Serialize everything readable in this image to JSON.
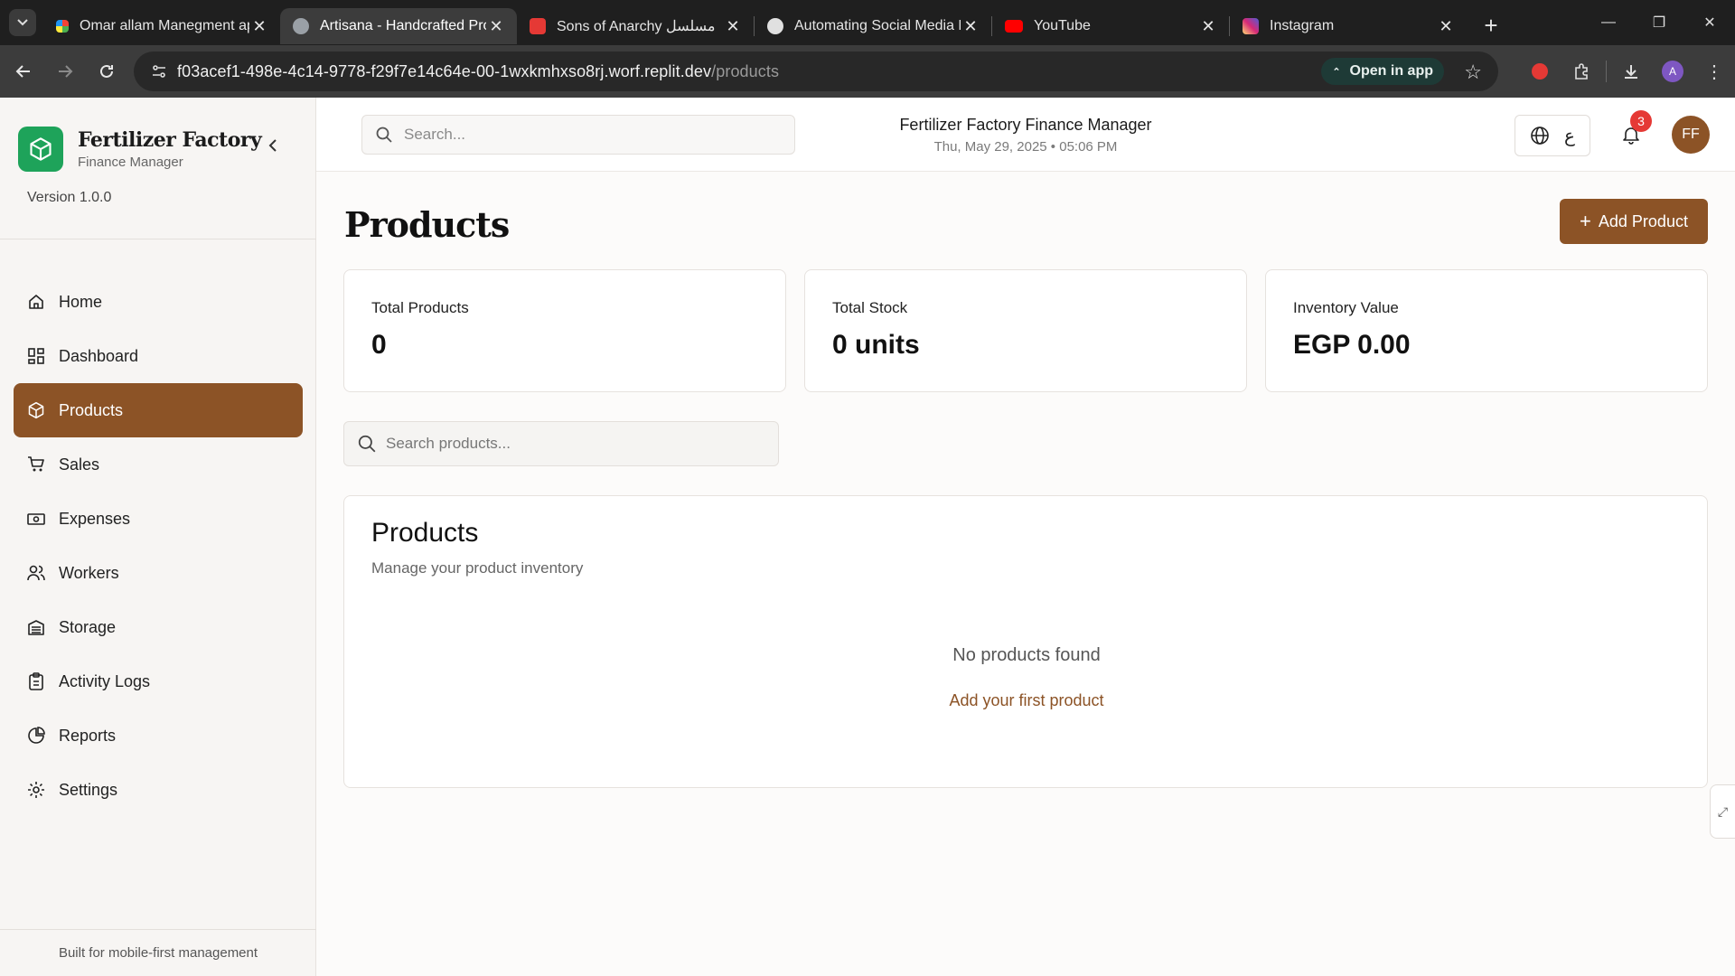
{
  "browser": {
    "tabs": [
      {
        "title": "Omar allam Manegment ap",
        "favicon_color": "#1f1f1f"
      },
      {
        "title": "Artisana - Handcrafted Pro",
        "favicon_color": "#9aa0a6"
      },
      {
        "title": "Sons of Anarchy مسلسل",
        "favicon_color": "#e53935"
      },
      {
        "title": "Automating Social Media P",
        "favicon_color": "#e0e0e0"
      },
      {
        "title": "YouTube",
        "favicon_color": "#ff0000"
      },
      {
        "title": "Instagram",
        "favicon_color": "#d62976"
      }
    ],
    "url_host": "f03acef1-498e-4c14-9778-f29f7e14c64e-00-1wxkmhxso8rj.worf.replit.dev",
    "url_path": "/products",
    "open_in_app": "Open in app",
    "profile_initial": "A"
  },
  "sidebar": {
    "brand_name": "Fertilizer Factory",
    "brand_sub": "Finance Manager",
    "version": "Version 1.0.0",
    "items": [
      {
        "label": "Home",
        "icon": "home-icon"
      },
      {
        "label": "Dashboard",
        "icon": "dashboard-icon"
      },
      {
        "label": "Products",
        "icon": "package-icon"
      },
      {
        "label": "Sales",
        "icon": "cart-icon"
      },
      {
        "label": "Expenses",
        "icon": "banknote-icon"
      },
      {
        "label": "Workers",
        "icon": "users-icon"
      },
      {
        "label": "Storage",
        "icon": "warehouse-icon"
      },
      {
        "label": "Activity Logs",
        "icon": "clipboard-icon"
      },
      {
        "label": "Reports",
        "icon": "pie-chart-icon"
      },
      {
        "label": "Settings",
        "icon": "gear-icon"
      }
    ],
    "active_item": "Products",
    "footer": "Built for mobile-first management"
  },
  "header": {
    "search_placeholder": "Search...",
    "title": "Fertilizer Factory Finance Manager",
    "datetime": "Thu, May 29, 2025 • 05:06 PM",
    "lang_glyph": "ع",
    "notification_count": "3",
    "avatar_initials": "FF"
  },
  "page": {
    "title": "Products",
    "add_button": "Add Product",
    "stats": [
      {
        "label": "Total Products",
        "value": "0"
      },
      {
        "label": "Total Stock",
        "value": "0 units"
      },
      {
        "label": "Inventory Value",
        "value": "EGP 0.00"
      }
    ],
    "search_placeholder": "Search products...",
    "panel": {
      "title": "Products",
      "subtitle": "Manage your product inventory",
      "empty_text": "No products found",
      "empty_link": "Add your first product"
    }
  },
  "colors": {
    "accent": "#8c5326",
    "brand_green": "#1ea35a",
    "badge": "#e53935"
  }
}
